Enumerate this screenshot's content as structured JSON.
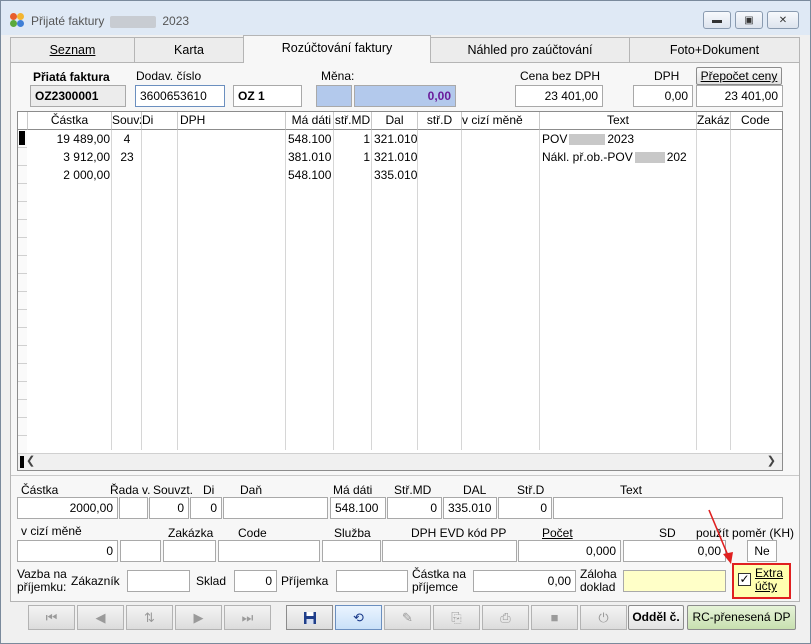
{
  "window": {
    "title": "Přijaté faktury",
    "title_year": "2023"
  },
  "tabs": [
    {
      "label": "Seznam"
    },
    {
      "label": "Karta"
    },
    {
      "label": "Rozúčtování faktury"
    },
    {
      "label": "Náhled pro zaúčtování"
    },
    {
      "label": "Foto+Dokument"
    }
  ],
  "header": {
    "invoice_label": "Přiatá faktura",
    "invoice_value": "OZ2300001",
    "supplier_no_label": "Dodav.  číslo",
    "supplier_no_value": "3600653610",
    "series_value": "OZ    1",
    "currency_label": "Měna:",
    "currency_value": "",
    "currency_amount": "0,00",
    "price_label": "Cena bez DPH",
    "price_value": "23 401,00",
    "vat_label": "DPH",
    "vat_value": "0,00",
    "recalc_label": "Přepočet ceny",
    "recalc_value": "23 401,00"
  },
  "grid": {
    "columns": [
      "Částka",
      "Souvz",
      "Di",
      "DPH",
      "Má dáti",
      "stř.MD",
      "Dal",
      "stř.D",
      "v cizí měně",
      "Text",
      "Zakázk",
      "Code"
    ],
    "rows": [
      {
        "amount": "19 489,00",
        "souvz": "4",
        "di": "",
        "dph": "",
        "debit": "548.100",
        "cc_md": "1",
        "credit": "321.010",
        "cc_d": "",
        "foreign": "",
        "text_pre": "POV",
        "text_post": "2023"
      },
      {
        "amount": "3 912,00",
        "souvz": "23",
        "di": "",
        "dph": "",
        "debit": "381.010",
        "cc_md": "1",
        "credit": "321.010",
        "cc_d": "",
        "foreign": "",
        "text_pre": "Nákl. př.ob.-POV",
        "text_post": "202"
      },
      {
        "amount": "2 000,00",
        "souvz": "",
        "di": "",
        "dph": "",
        "debit": "548.100",
        "cc_md": "",
        "credit": "335.010",
        "cc_d": "",
        "foreign": "",
        "text_pre": "",
        "text_post": ""
      }
    ]
  },
  "detail": {
    "labels": {
      "amount": "Částka",
      "row": "Řada v.",
      "souvz": "Souvzt.",
      "di": "Di",
      "tax": "Daň",
      "debit": "Má dáti",
      "cc_md": "Stř.MD",
      "credit": "DAL",
      "cc_d": "Stř.D",
      "text": "Text",
      "foreign": "v cizí měně",
      "order": "Zakázka",
      "code": "Code",
      "service": "Služba",
      "vat_evd": "DPH EVD kód PP",
      "count": "Počet",
      "sd": "SD",
      "ratio": "použít poměr (KH)",
      "link": "Vazba na příjemku:",
      "customer": "Zákazník",
      "warehouse": "Sklad",
      "receipt": "Příjemka",
      "receipt_amount": "Částka na příjemce",
      "advance": "Záloha doklad",
      "extra": "Extra účty"
    },
    "values": {
      "amount": "2000,00",
      "row": "",
      "souvz": "0",
      "di": "0",
      "tax": "",
      "debit": "548.100",
      "cc_md": "0",
      "credit": "335.010",
      "cc_d": "0",
      "text": "",
      "foreign": "0",
      "count": "0,000",
      "sd": "0,00",
      "ratio": "Ne",
      "customer": "",
      "warehouse": "0",
      "receipt": "",
      "receipt_amount": "0,00",
      "advance": ""
    }
  },
  "toolbar": {
    "odd_label": "Odděl č.",
    "rc_label": "RC-přenesená DP"
  }
}
